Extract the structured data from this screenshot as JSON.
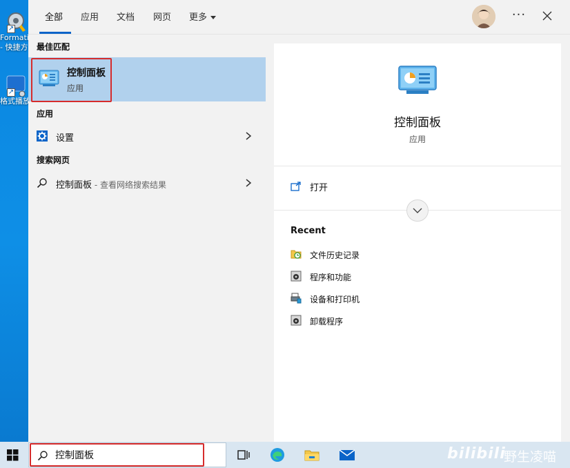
{
  "desktop": {
    "icons": [
      {
        "label_line1": "Formatic",
        "label_line2": "- 快捷方"
      },
      {
        "label_line1": "格式播放",
        "label_line2": ""
      }
    ]
  },
  "tabs": [
    {
      "label": "全部",
      "active": true
    },
    {
      "label": "应用",
      "active": false
    },
    {
      "label": "文档",
      "active": false
    },
    {
      "label": "网页",
      "active": false
    },
    {
      "label": "更多",
      "active": false
    }
  ],
  "header": {
    "more_label": "···"
  },
  "best_match": {
    "heading": "最佳匹配",
    "title": "控制面板",
    "subtitle": "应用"
  },
  "apps_section": {
    "heading": "应用",
    "items": [
      {
        "label": "设置",
        "icon": "gear-icon"
      }
    ]
  },
  "web_section": {
    "heading": "搜索网页",
    "items": [
      {
        "label": "控制面板",
        "hint": " - 查看网络搜索结果",
        "icon": "search-icon"
      }
    ]
  },
  "preview": {
    "app_name": "控制面板",
    "app_type": "应用",
    "open_label": "打开",
    "recent_heading": "Recent",
    "recent_items": [
      {
        "label": "文件历史记录",
        "icon": "file-history-icon"
      },
      {
        "label": "程序和功能",
        "icon": "programs-icon"
      },
      {
        "label": "设备和打印机",
        "icon": "printer-icon"
      },
      {
        "label": "卸载程序",
        "icon": "uninstall-icon"
      }
    ]
  },
  "taskbar": {
    "search_value": "控制面板",
    "watermark_brand": "bilibili",
    "watermark_user": "野生凌喵"
  },
  "colors": {
    "accent": "#0a64c8",
    "selection": "#b1d1ed",
    "highlight_border": "#d62b2b",
    "desktop": "#0b86e0",
    "taskbar": "#d9e6f1"
  }
}
